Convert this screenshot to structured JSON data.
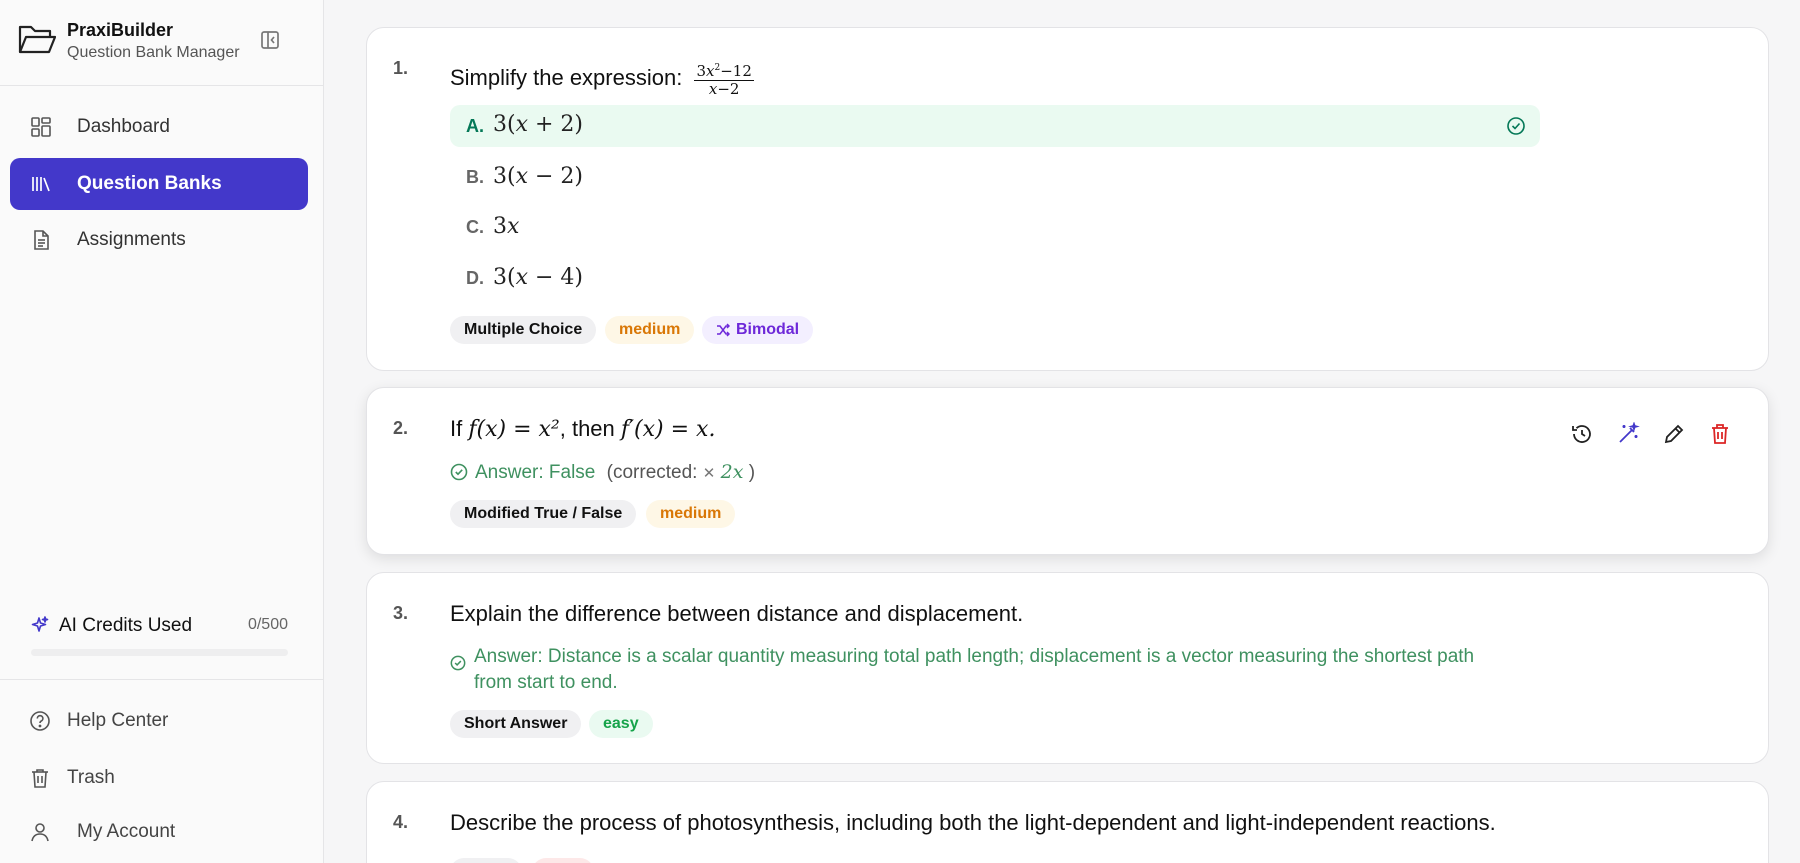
{
  "brand": {
    "name": "PraxiBuilder",
    "subtitle": "Question Bank Manager"
  },
  "nav": [
    {
      "label": "Dashboard",
      "icon": "dashboard-icon",
      "active": false
    },
    {
      "label": "Question Banks",
      "icon": "library-icon",
      "active": true
    },
    {
      "label": "Assignments",
      "icon": "document-icon",
      "active": false
    }
  ],
  "credits": {
    "label": "AI Credits Used",
    "count": "0/500",
    "used": 0,
    "total": 500
  },
  "footer": [
    {
      "label": "Help Center",
      "icon": "help-icon"
    },
    {
      "label": "Trash",
      "icon": "trash-icon"
    },
    {
      "label": "My Account",
      "icon": "user-icon"
    }
  ],
  "colors": {
    "accent": "#4338ca",
    "success": "#3f9160",
    "warning": "#d97706",
    "danger": "#dc2626",
    "purple": "#6d28d9"
  },
  "questions": [
    {
      "number": "1.",
      "text_prefix": "Simplify the expression:",
      "text_formula": "3x²−12 / x−2",
      "options": [
        {
          "letter": "A.",
          "value": "3(x + 2)",
          "correct": true
        },
        {
          "letter": "B.",
          "value": "3(x − 2)",
          "correct": false
        },
        {
          "letter": "C.",
          "value": "3x",
          "correct": false
        },
        {
          "letter": "D.",
          "value": "3(x − 4)",
          "correct": false
        }
      ],
      "tags": {
        "type": "Multiple Choice",
        "difficulty": "medium",
        "extra": "Bimodal"
      }
    },
    {
      "number": "2.",
      "text_if": "If",
      "formula_a": "f(x) = x²",
      "text_then": ", then",
      "formula_b": "f′(x) = x.",
      "answer_label": "Answer: False",
      "corrected_prefix": "(corrected:",
      "corrected_value": "2x",
      "corrected_suffix": ")",
      "tags": {
        "type": "Modified True / False",
        "difficulty": "medium"
      }
    },
    {
      "number": "3.",
      "text": "Explain the difference between distance and displacement.",
      "answer_line1": "Answer: Distance is a scalar quantity measuring total path length; displacement is a vector measuring the shortest path",
      "answer_line2": "from start to end.",
      "tags": {
        "type": "Short Answer",
        "difficulty": "easy"
      }
    },
    {
      "number": "4.",
      "text": "Describe the process of photosynthesis, including both the light-dependent and light-independent reactions."
    }
  ]
}
